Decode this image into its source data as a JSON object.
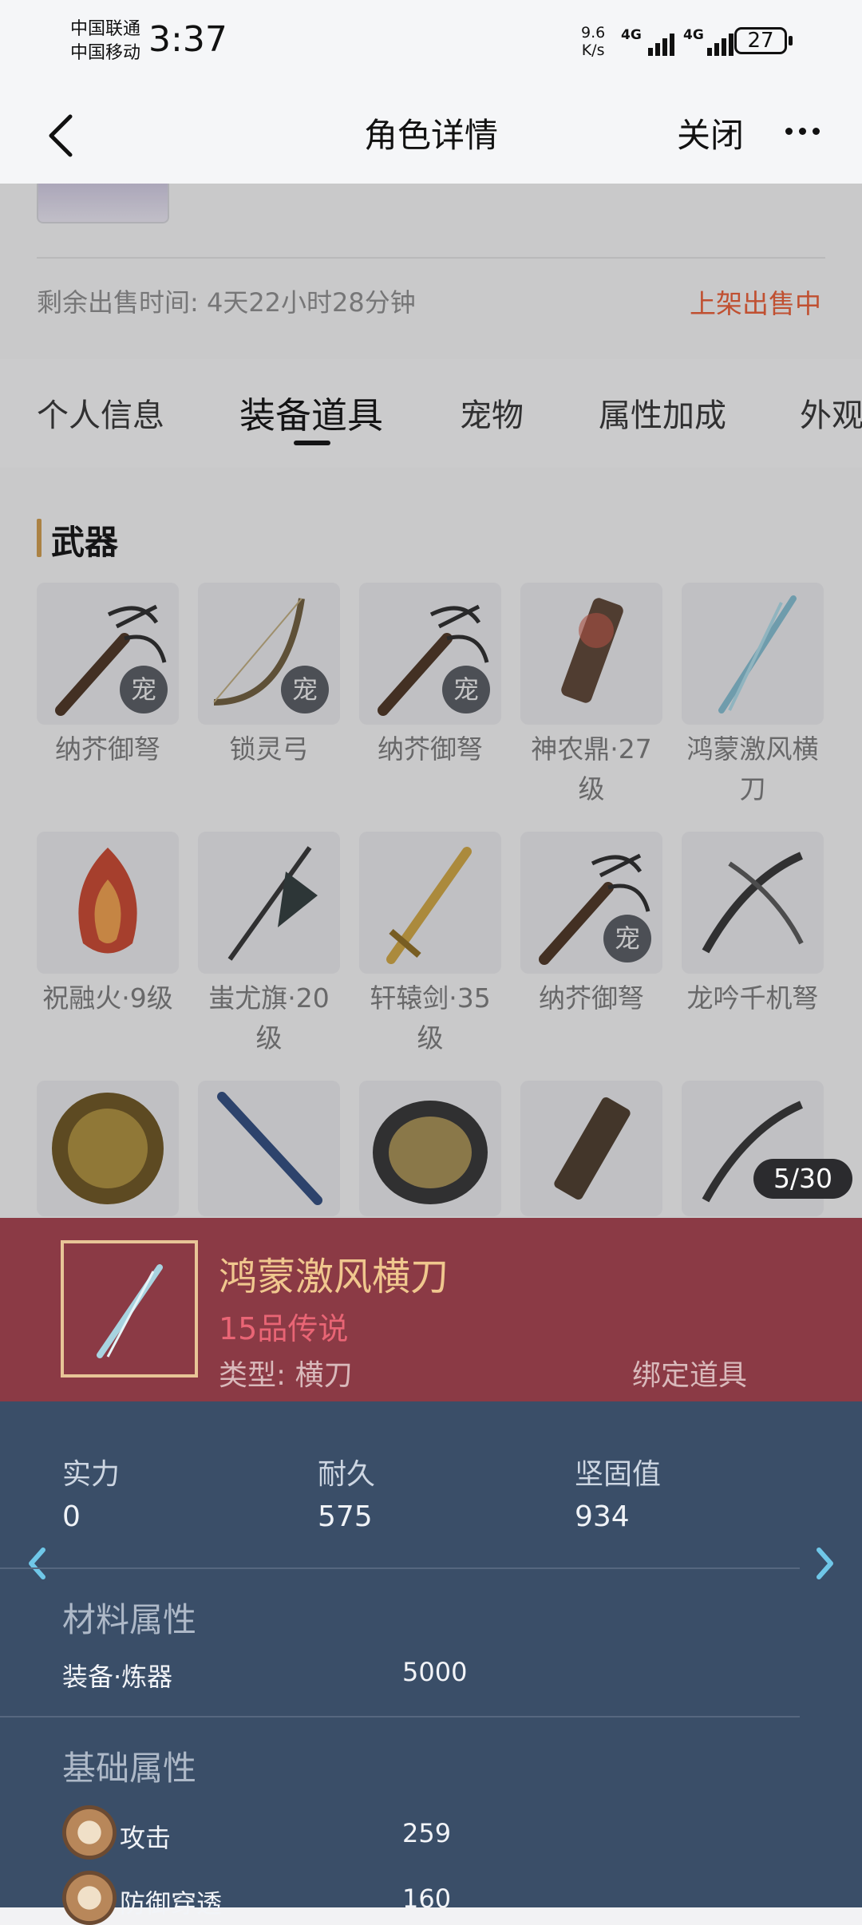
{
  "status_bar": {
    "carrier1": "中国联通",
    "carrier2": "中国移动",
    "time": "3:37",
    "speed_value": "9.6",
    "speed_unit": "K/s",
    "net1": "4G",
    "net2": "4G",
    "battery": "27"
  },
  "nav": {
    "title": "角色详情",
    "close_label": "关闭"
  },
  "sale": {
    "remaining_time": "剩余出售时间: 4天22小时28分钟",
    "status": "上架出售中"
  },
  "tabs": [
    "个人信息",
    "装备道具",
    "宠物",
    "属性加成",
    "外观"
  ],
  "section_title": "武器",
  "weapons": [
    {
      "name": "纳芥御弩",
      "pet": "宠"
    },
    {
      "name": "锁灵弓",
      "pet": "宠"
    },
    {
      "name": "纳芥御弩",
      "pet": "宠"
    },
    {
      "name": "神农鼎·27级"
    },
    {
      "name": "鸿蒙激风横刀"
    },
    {
      "name": "祝融火·9级"
    },
    {
      "name": "蚩尤旗·20级"
    },
    {
      "name": "轩辕剑·35级"
    },
    {
      "name": "纳芥御弩",
      "pet": "宠"
    },
    {
      "name": "龙吟千机弩"
    }
  ],
  "counter": "5/30",
  "detail": {
    "name": "鸿蒙激风横刀",
    "grade": "15品传说",
    "type": "类型:  横刀",
    "bind": "绑定道具",
    "stats": [
      {
        "label": "实力",
        "value": "0"
      },
      {
        "label": "耐久",
        "value": "575"
      },
      {
        "label": "坚固值",
        "value": "934"
      }
    ],
    "material_title": "材料属性",
    "material_name": "装备·炼器",
    "material_value": "5000",
    "base_title": "基础属性",
    "base_attrs": [
      {
        "name": "攻击",
        "value": "259"
      },
      {
        "name": "防御穿透",
        "value": "160"
      }
    ]
  },
  "colors": {
    "accent_red": "#e25a32",
    "detail_head": "#8b3a45",
    "detail_body": "#3a4e68",
    "gold": "#f0c78e"
  }
}
